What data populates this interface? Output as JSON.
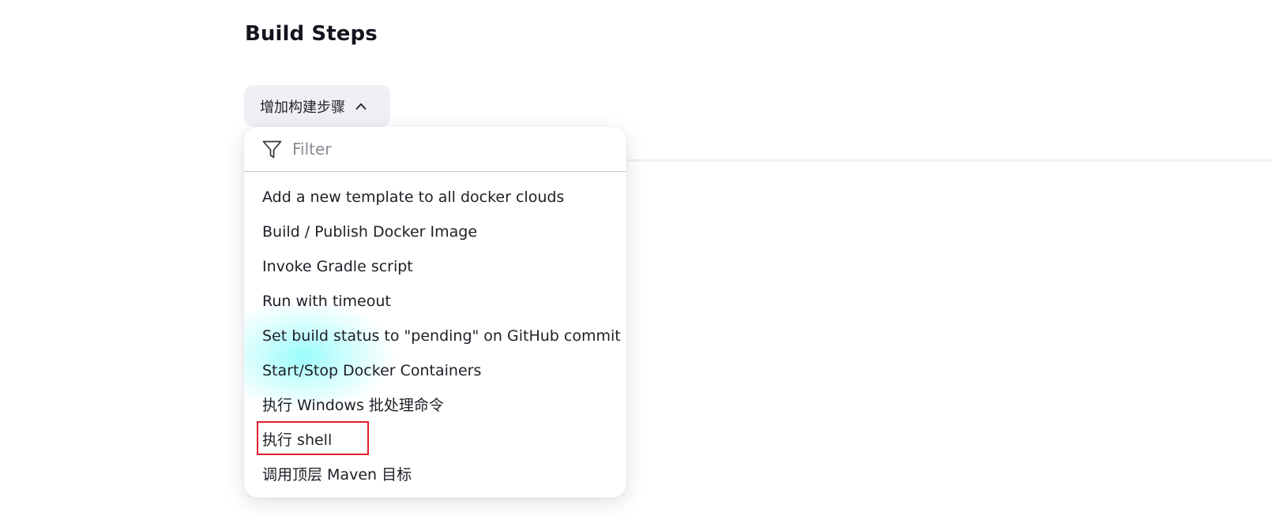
{
  "section": {
    "title": "Build Steps"
  },
  "add_step_button": {
    "label": "增加构建步骤",
    "icon": "chevron-up-icon"
  },
  "dropdown": {
    "filter": {
      "icon": "filter-icon",
      "placeholder": "Filter",
      "value": ""
    },
    "items": [
      {
        "label": "Add a new template to all docker clouds"
      },
      {
        "label": "Build / Publish Docker Image"
      },
      {
        "label": "Invoke Gradle script"
      },
      {
        "label": "Run with timeout"
      },
      {
        "label": "Set build status to \"pending\" on GitHub commit"
      },
      {
        "label": "Start/Stop Docker Containers"
      },
      {
        "label": "执行 Windows 批处理命令"
      },
      {
        "label": "执行 shell"
      },
      {
        "label": "调用顶层 Maven 目标"
      }
    ],
    "highlighted_item": "执行 shell"
  },
  "colors": {
    "button_bg": "#eef0f5",
    "highlight_border": "#e0202a",
    "glow": "#8ef9f9"
  }
}
